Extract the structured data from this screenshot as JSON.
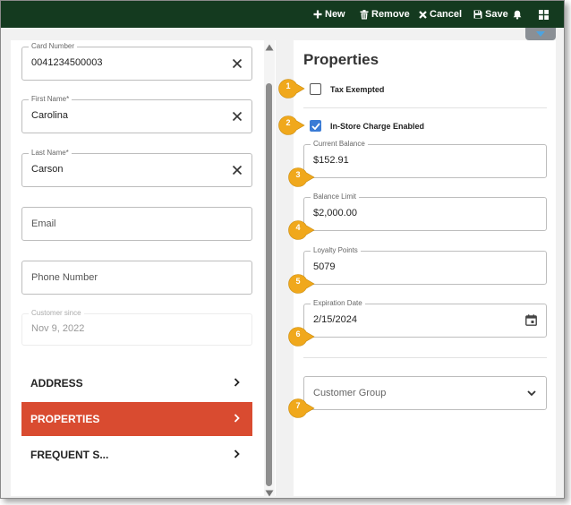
{
  "toolbar": {
    "new_label": "New",
    "remove_label": "Remove",
    "cancel_label": "Cancel",
    "save_label": "Save"
  },
  "left": {
    "card_number": {
      "label": "Card Number",
      "value": "0041234500003"
    },
    "first_name": {
      "label": "First Name*",
      "value": "Carolina"
    },
    "last_name": {
      "label": "Last Name*",
      "value": "Carson"
    },
    "email": {
      "placeholder": "Email"
    },
    "phone": {
      "placeholder": "Phone Number"
    },
    "customer_since": {
      "label": "Customer since",
      "value": "Nov 9, 2022"
    },
    "nav": [
      {
        "label": "ADDRESS",
        "active": false
      },
      {
        "label": "PROPERTIES",
        "active": true
      },
      {
        "label": "FREQUENT S...",
        "active": false
      }
    ]
  },
  "right": {
    "title": "Properties",
    "tax_exempted": {
      "label": "Tax Exempted",
      "checked": false
    },
    "instore_charge": {
      "label": "In-Store Charge Enabled",
      "checked": true
    },
    "current_balance": {
      "label": "Current Balance",
      "value": "$152.91"
    },
    "balance_limit": {
      "label": "Balance Limit",
      "value": "$2,000.00"
    },
    "loyalty_points": {
      "label": "Loyalty Points",
      "value": "5079"
    },
    "expiration_date": {
      "label": "Expiration Date",
      "value": "2/15/2024"
    },
    "customer_group": {
      "placeholder": "Customer Group"
    }
  },
  "callouts": [
    "1",
    "2",
    "3",
    "4",
    "5",
    "6",
    "7"
  ],
  "colors": {
    "topbar": "#143a1f",
    "active_nav": "#d94b30",
    "callout": "#f0a81c",
    "checkbox": "#3a7bd5"
  },
  "icons": {
    "new": "plus-icon",
    "remove": "trash-icon",
    "cancel": "x-icon",
    "save": "floppy-icon",
    "notifications": "bell-icon",
    "apps": "grid-icon"
  }
}
